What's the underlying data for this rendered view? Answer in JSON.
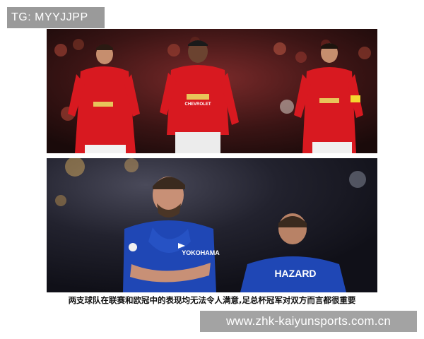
{
  "header": {
    "tag_label": "TG: MYYJJPP"
  },
  "photos": {
    "top": {
      "jersey_sponsor": "CHEVROLET"
    },
    "bottom": {
      "jersey_sponsor": "YOKOHAMA",
      "player_name": "HAZARD"
    }
  },
  "caption": "两支球队在联赛和欧冠中的表现均无法令人满意,足总杯冠军对双方而言都很重要",
  "watermark": {
    "url": "www.zhk-kaiyunsports.com.cn"
  },
  "colors": {
    "united_red": "#d81920",
    "chelsea_blue": "#1f47b5",
    "badge_gray": "#9a9a9a"
  }
}
